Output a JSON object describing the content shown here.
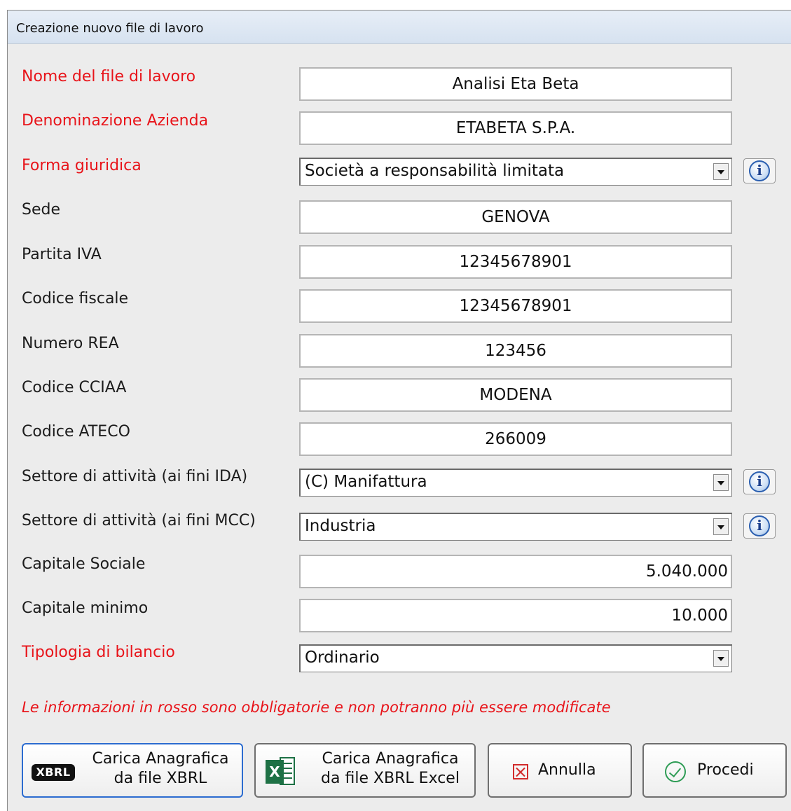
{
  "window": {
    "title": "Creazione nuovo file di lavoro"
  },
  "fields": {
    "nome_file": {
      "label": "Nome del file di lavoro",
      "value": "Analisi Eta Beta"
    },
    "denominazione": {
      "label": "Denominazione Azienda",
      "value": "ETABETA S.P.A."
    },
    "forma_giuridica": {
      "label": "Forma giuridica",
      "value": "Società a responsabilità limitata"
    },
    "sede": {
      "label": "Sede",
      "value": "GENOVA"
    },
    "partita_iva": {
      "label": "Partita IVA",
      "value": "12345678901"
    },
    "codice_fiscale": {
      "label": "Codice fiscale",
      "value": "12345678901"
    },
    "numero_rea": {
      "label": "Numero REA",
      "value": "123456"
    },
    "codice_cciaa": {
      "label": "Codice CCIAA",
      "value": "MODENA"
    },
    "codice_ateco": {
      "label": "Codice ATECO",
      "value": "266009"
    },
    "settore_ida": {
      "label": "Settore di attività (ai fini IDA)",
      "value": "(C) Manifattura"
    },
    "settore_mcc": {
      "label": "Settore di attività (ai fini MCC)",
      "value": "Industria"
    },
    "capitale_sociale": {
      "label": "Capitale Sociale",
      "value": "5.040.000"
    },
    "capitale_minimo": {
      "label": "Capitale minimo",
      "value": "10.000"
    },
    "tipologia_bilancio": {
      "label": "Tipologia di bilancio",
      "value": "Ordinario"
    }
  },
  "note": "Le informazioni in rosso sono obbligatorie e non potranno più essere modificate",
  "buttons": {
    "xbrl": {
      "logo": "XBRL",
      "line1": "Carica Anagrafica",
      "line2": "da file XBRL"
    },
    "excel": {
      "logo": "X",
      "line1": "Carica Anagrafica",
      "line2": "da file XBRL Excel"
    },
    "annulla": {
      "label": "Annulla"
    },
    "procedi": {
      "label": "Procedi"
    }
  },
  "colors": {
    "required_label": "#e8141a",
    "title_bar": "#dbe5f1",
    "excel_green": "#1e7145"
  }
}
